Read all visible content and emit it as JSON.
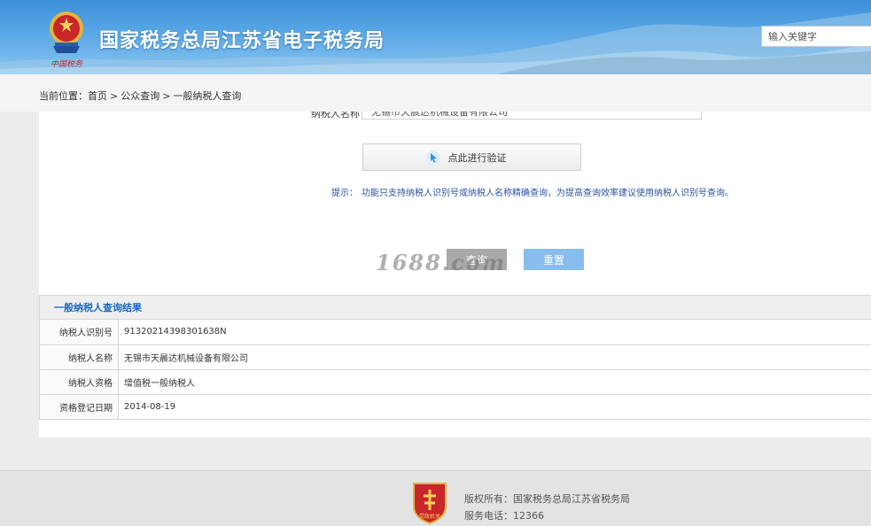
{
  "header": {
    "site_title": "国家税务总局江苏省电子税务局",
    "emblem_text": "中国税务",
    "search_placeholder": "输入关键字"
  },
  "breadcrumb": {
    "prefix": "当前位置：",
    "items": [
      "首页",
      "公众查询",
      "一般纳税人查询"
    ],
    "separator": ">"
  },
  "form": {
    "cut_label": "纳税人名称",
    "cut_value": "无锡市天晨达机械设备有限公司",
    "verify_label": "点此进行验证",
    "tip_label": "提示：",
    "tip_text": "功能只支持纳税人识别号或纳税人名称精确查询，为提高查询效率建议使用纳税人识别号查询。",
    "query_label": "查询",
    "reset_label": "重置"
  },
  "watermark": "1688.com",
  "results": {
    "title": "一般纳税人查询结果",
    "rows": [
      {
        "label": "纳税人识别号",
        "value": "91320214398301638N"
      },
      {
        "label": "纳税人名称",
        "value": "无锡市天晨达机械设备有限公司"
      },
      {
        "label": "纳税人资格",
        "value": "增值税一般纳税人"
      },
      {
        "label": "资格登记日期",
        "value": "2014-08-19"
      }
    ]
  },
  "footer": {
    "badge_text": "党政机关",
    "copyright": "版权所有：国家税务总局江苏省税务局",
    "phone": "服务电话：12366"
  },
  "colors": {
    "header_blue": "#3c8fd8",
    "link_blue": "#1b6bbe",
    "tip_blue": "#2a52a8",
    "reset_button": "#88bdee",
    "query_button": "#a9a9a9"
  }
}
